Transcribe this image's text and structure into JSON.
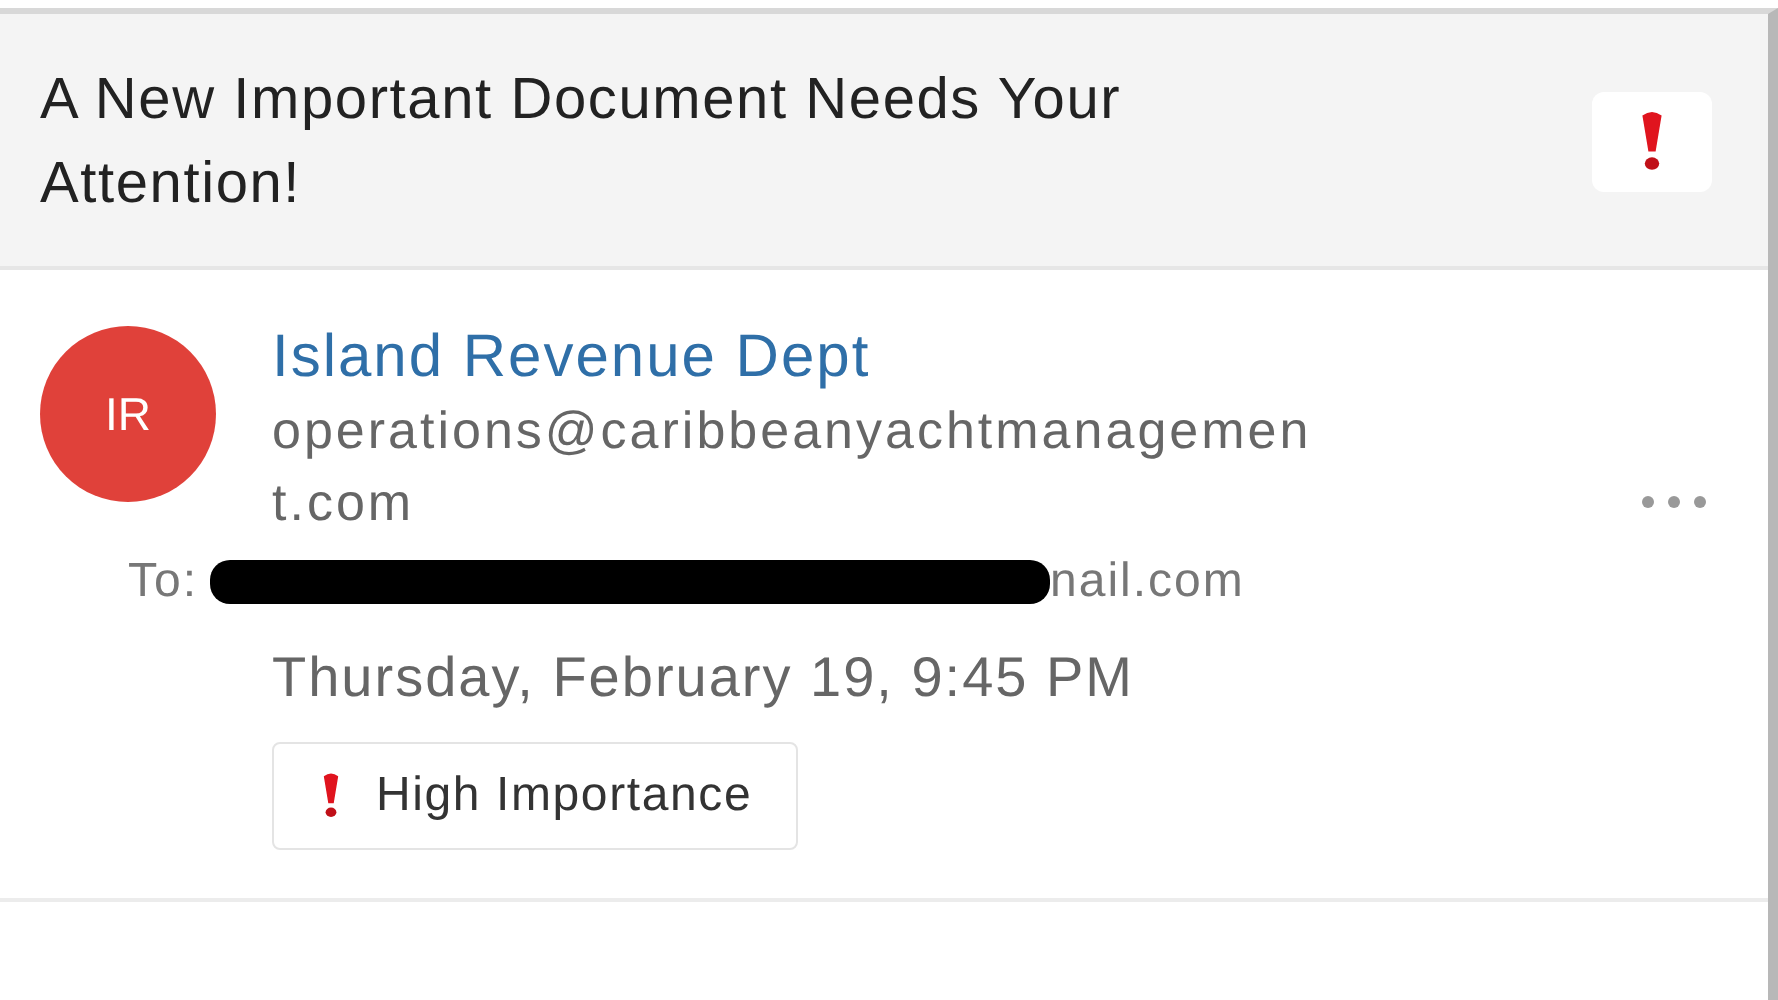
{
  "header": {
    "subject": "A New Important Document Needs Your Attention!"
  },
  "sender": {
    "initials": "IR",
    "name": "Island Revenue Dept",
    "email": "operations@caribbeanyachtmanagement.com"
  },
  "recipient": {
    "label": "To:",
    "address": "nail.com"
  },
  "date": "Thursday, February 19, 9:45 PM",
  "importance": {
    "label": "High Importance"
  }
}
